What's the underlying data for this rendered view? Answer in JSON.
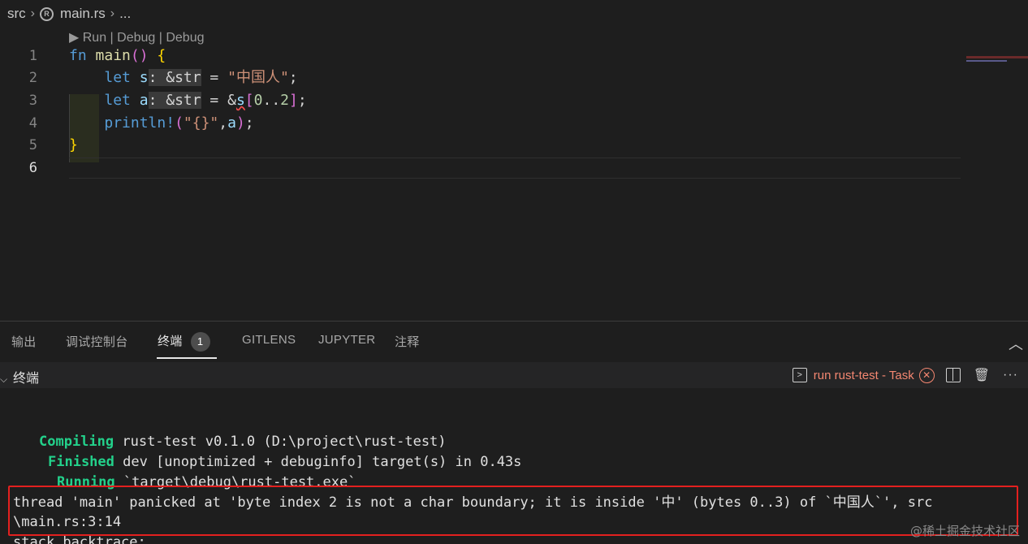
{
  "breadcrumb": {
    "folder": "src",
    "file": "main.rs",
    "more": "..."
  },
  "editor": {
    "codelens": "▶ Run | Debug | Debug",
    "line_numbers": [
      "1",
      "2",
      "3",
      "4",
      "5",
      "6"
    ],
    "lines": {
      "l1": {
        "kw": "fn",
        "name": "main",
        "parens": "()",
        "brace": "{"
      },
      "l2": {
        "kw": "let",
        "var": "s",
        "hint": ": &str",
        "eq": " = ",
        "str": "\"中国人\"",
        "end": ";"
      },
      "l3": {
        "kw": "let",
        "var": "a",
        "hint": ": &str",
        "eq": " = ",
        "amp": "&",
        "var2": "s",
        "open": "[",
        "num1": "0",
        "range": "..",
        "num2": "2",
        "close": "]",
        "end": ";"
      },
      "l4": {
        "macro": "println!",
        "open": "(",
        "str": "\"{}\"",
        "comma": ",",
        "var": "a",
        "close": ")",
        "end": ";"
      },
      "l5": {
        "brace": "}"
      }
    }
  },
  "panel": {
    "tabs": [
      "输出",
      "调试控制台",
      "终端",
      "GITLENS",
      "JUPYTER",
      "注释"
    ],
    "active_tab_badge": "1",
    "terminal_title": "终端",
    "task_label": "run rust-test - Task"
  },
  "terminal": {
    "compiling_label": "Compiling",
    "compiling_text": " rust-test v0.1.0 (D:\\project\\rust-test)",
    "finished_label": "Finished",
    "finished_text": " dev [unoptimized + debuginfo] target(s) in 0.43s",
    "running_label": "Running",
    "running_text": " `target\\debug\\rust-test.exe`",
    "panic_line1": "thread 'main' panicked at 'byte index 2 is not a char boundary; it is inside '中' (bytes 0..3) of `中国人`', src",
    "panic_line2": "\\main.rs:3:14",
    "backtrace": "stack backtrace:"
  },
  "watermark": "@稀土掘金技术社区",
  "colors": {
    "background": "#1e1e1e",
    "error_box": "#e3201f",
    "cargo_green": "#23d18b",
    "task_red": "#f48771"
  }
}
